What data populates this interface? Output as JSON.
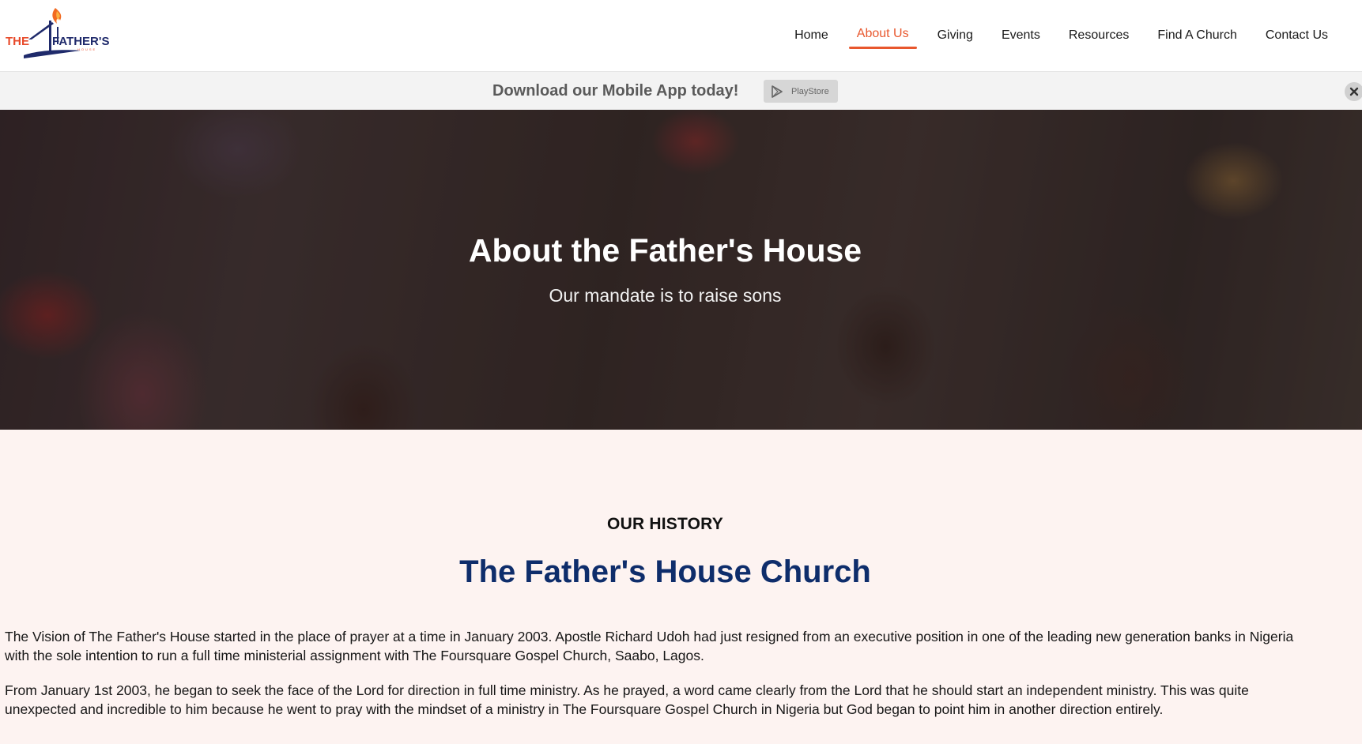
{
  "header": {
    "logo_text": "THE FATHER'S HOUSE",
    "nav": [
      {
        "label": "Home",
        "active": false
      },
      {
        "label": "About Us",
        "active": true
      },
      {
        "label": "Giving",
        "active": false
      },
      {
        "label": "Events",
        "active": false
      },
      {
        "label": "Resources",
        "active": false
      },
      {
        "label": "Find A Church",
        "active": false
      },
      {
        "label": "Contact Us",
        "active": false
      }
    ],
    "accent_color": "#e8572d"
  },
  "app_banner": {
    "text": "Download our Mobile App today!",
    "store_label": "PlayStore",
    "store_icon": "play-store-icon",
    "close_icon": "close-icon"
  },
  "hero": {
    "title": "About the Father's House",
    "subtitle": "Our mandate is to raise sons"
  },
  "history": {
    "eyebrow": "OUR HISTORY",
    "title": "The Father's House Church",
    "title_color": "#0e2d6b",
    "paragraphs": [
      "The Vision of The Father's House started in the place of prayer at a time in January 2003. Apostle Richard Udoh had just resigned from an executive position in one of the leading new generation banks in Nigeria with the sole intention to run a full time ministerial assignment with The Foursquare Gospel Church, Saabo, Lagos.",
      "From January 1st 2003, he began to seek the face of the Lord for direction in full time ministry. As he prayed, a word came clearly from the Lord that he should start an independent ministry. This was quite unexpected and incredible to him because he went to pray with the mindset of a ministry in The Foursquare Gospel Church in Nigeria but God began to point him in another direction entirely."
    ]
  }
}
